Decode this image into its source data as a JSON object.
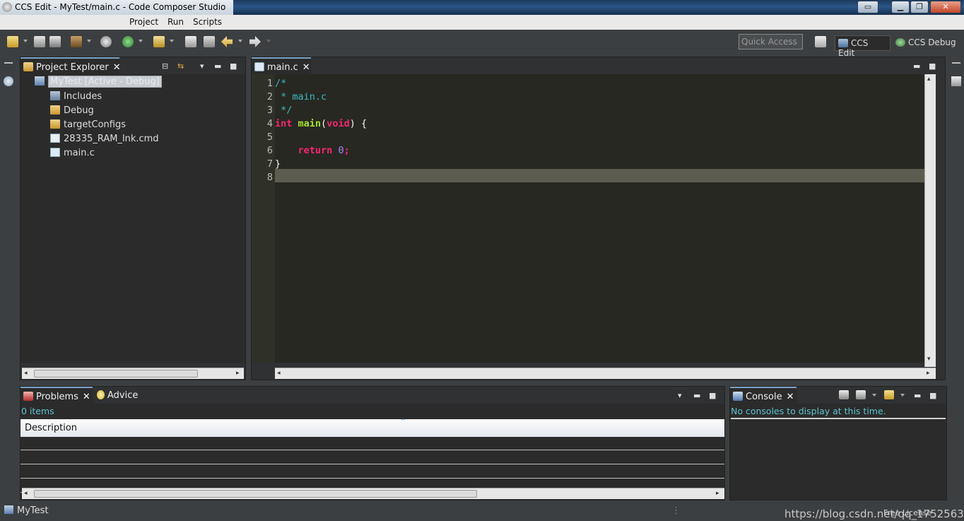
{
  "window": {
    "title": "CCS Edit - MyTest/main.c - Code Composer Studio"
  },
  "menu": {
    "items": [
      "Project",
      "Run",
      "Scripts"
    ]
  },
  "toolbar": {
    "quick_access_placeholder": "Quick Access",
    "perspectives": [
      {
        "label": "CCS Edit",
        "active": true
      },
      {
        "label": "CCS Debug",
        "active": false
      }
    ]
  },
  "project_explorer": {
    "tab_label": "Project Explorer",
    "project": "MyTest  [Active - Debug]",
    "items": [
      {
        "label": "Includes",
        "icon": "includes-icon"
      },
      {
        "label": "Debug",
        "icon": "folder-icon"
      },
      {
        "label": "targetConfigs",
        "icon": "folder-icon"
      },
      {
        "label": "28335_RAM_lnk.cmd",
        "icon": "cmd-file-icon"
      },
      {
        "label": "main.c",
        "icon": "c-file-icon"
      }
    ]
  },
  "editor": {
    "tab_label": "main.c",
    "line_numbers": [
      "1",
      "2",
      "3",
      "4",
      "5",
      "6",
      "7",
      "8"
    ],
    "code": {
      "l1": "/*",
      "l2": " * main.c",
      "l3": " */",
      "l4_kw": "int",
      "l4_fn": "main",
      "l4_open": "(",
      "l4_void": "void",
      "l4_close": ") {",
      "l6_kw": "return",
      "l6_num": "0",
      "l6_semi": ";",
      "l7": "}"
    }
  },
  "problems": {
    "tab_label": "Problems",
    "advice_tab_label": "Advice",
    "count_text": "0 items",
    "column_header": "Description"
  },
  "console": {
    "tab_label": "Console",
    "message": "No consoles to display at this time."
  },
  "status": {
    "project": "MyTest",
    "watermark": "https://blog.csdn.net/qq_17525633",
    "license": "Free License"
  },
  "colors": {
    "editor_bg": "#272822",
    "keyword": "#f92672",
    "function": "#a6e22e",
    "comment": "#3fb8c2",
    "number": "#ae81ff",
    "info_text": "#5ec4cf"
  }
}
